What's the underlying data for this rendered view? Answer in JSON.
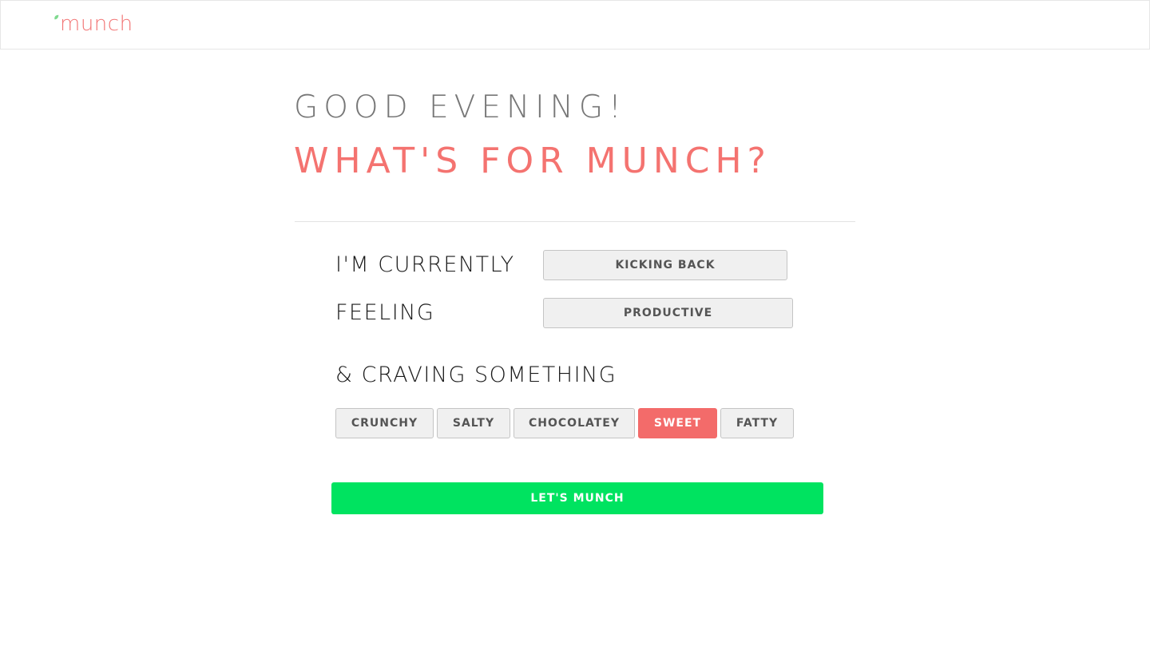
{
  "navbar": {
    "logo_text": "munch",
    "logo_icon": "leaf-icon",
    "brand_color": "#f27575",
    "leaf_color": "#7fd98f"
  },
  "greeting": "GOOD EVENING!",
  "headline": "WHAT'S FOR MUNCH?",
  "form": {
    "currently_label": "I'M CURRENTLY",
    "currently_value": "KICKING BACK",
    "feeling_label": "FEELING",
    "feeling_value": "PRODUCTIVE",
    "craving_label": "& CRAVING SOMETHING",
    "cravings": [
      {
        "label": "CRUNCHY",
        "selected": false
      },
      {
        "label": "SALTY",
        "selected": false
      },
      {
        "label": "CHOCOLATEY",
        "selected": false
      },
      {
        "label": "SWEET",
        "selected": true
      },
      {
        "label": "FATTY",
        "selected": false
      }
    ],
    "submit_label": "LET'S MUNCH"
  },
  "colors": {
    "accent": "#f47370",
    "selected_chip": "#f36b6a",
    "cta": "#00e360",
    "greeting": "#777777"
  }
}
